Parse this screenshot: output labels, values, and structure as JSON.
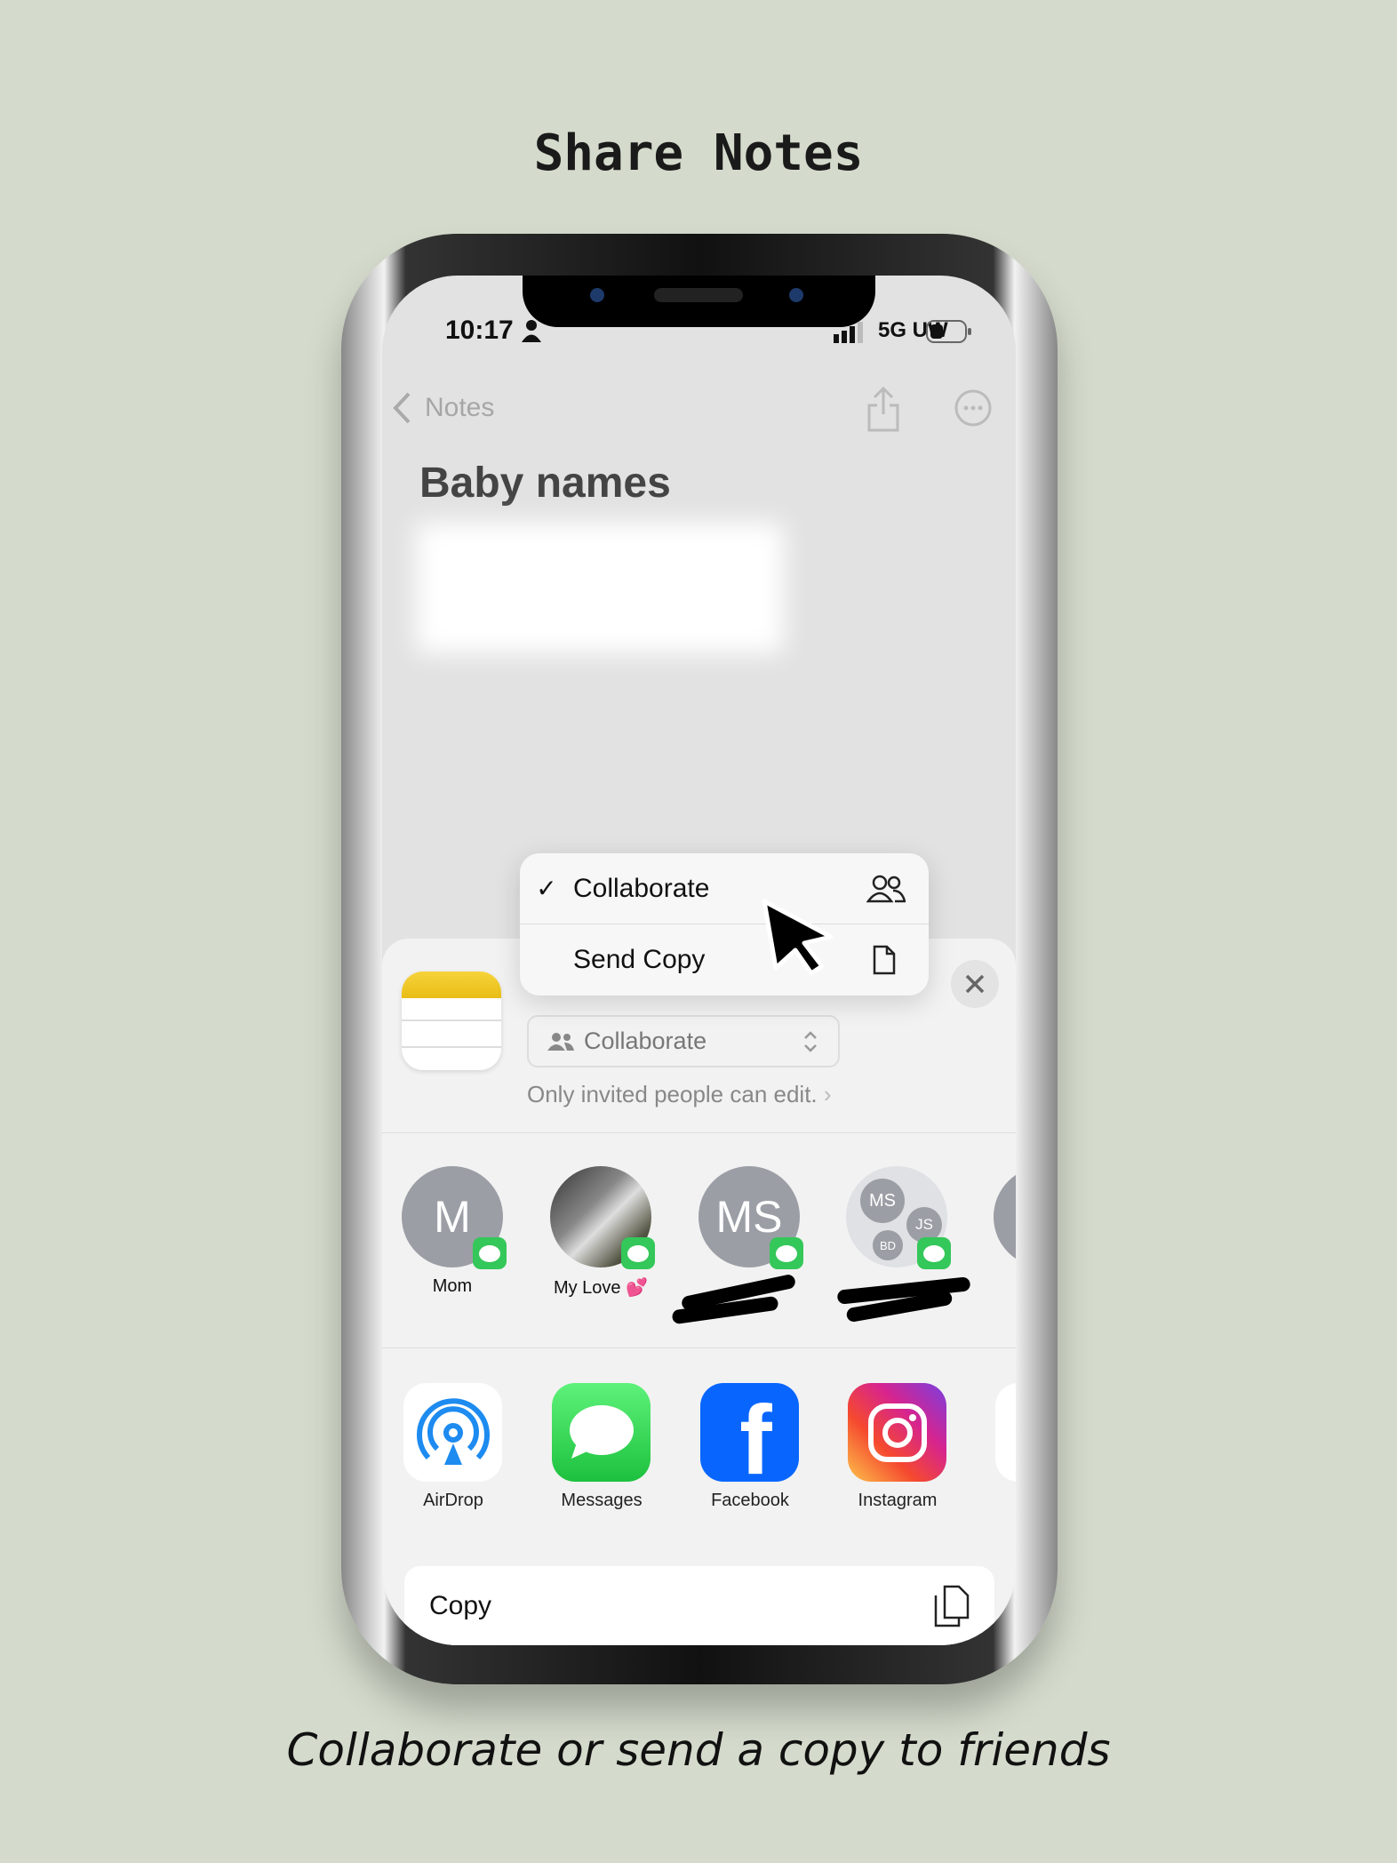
{
  "heading": "Share Notes",
  "caption": "Collaborate or send a copy to friends",
  "status_bar": {
    "time": "10:17",
    "network": "5G UW",
    "icons": [
      "person-icon",
      "signal-icon",
      "battery-icon"
    ]
  },
  "nav": {
    "back_label": "Notes",
    "icons": [
      "chevron-left-icon",
      "share-icon",
      "more-icon"
    ]
  },
  "note": {
    "title": "Baby names"
  },
  "menu": {
    "items": [
      {
        "label": "Collaborate",
        "checked": true,
        "icon": "people-icon"
      },
      {
        "label": "Send Copy",
        "checked": false,
        "icon": "document-icon"
      }
    ]
  },
  "share_sheet": {
    "mode_select": "Collaborate",
    "permission_text": "Only invited people can edit.",
    "contacts": [
      {
        "name": "Mom",
        "initials": "M"
      },
      {
        "name": "My Love 💕",
        "initials": ""
      },
      {
        "name": "",
        "initials": "MS"
      },
      {
        "name": "",
        "initials": "MS JS BD",
        "members": [
          "MS",
          "JS",
          "BD"
        ]
      }
    ],
    "apps": [
      {
        "label": "AirDrop"
      },
      {
        "label": "Messages"
      },
      {
        "label": "Facebook"
      },
      {
        "label": "Instagram"
      }
    ],
    "copy_label": "Copy"
  },
  "colors": {
    "background": "#d4dbcc",
    "messages_green": "#34c759",
    "facebook_blue": "#0866ff",
    "airdrop_blue": "#1d8bf0"
  }
}
